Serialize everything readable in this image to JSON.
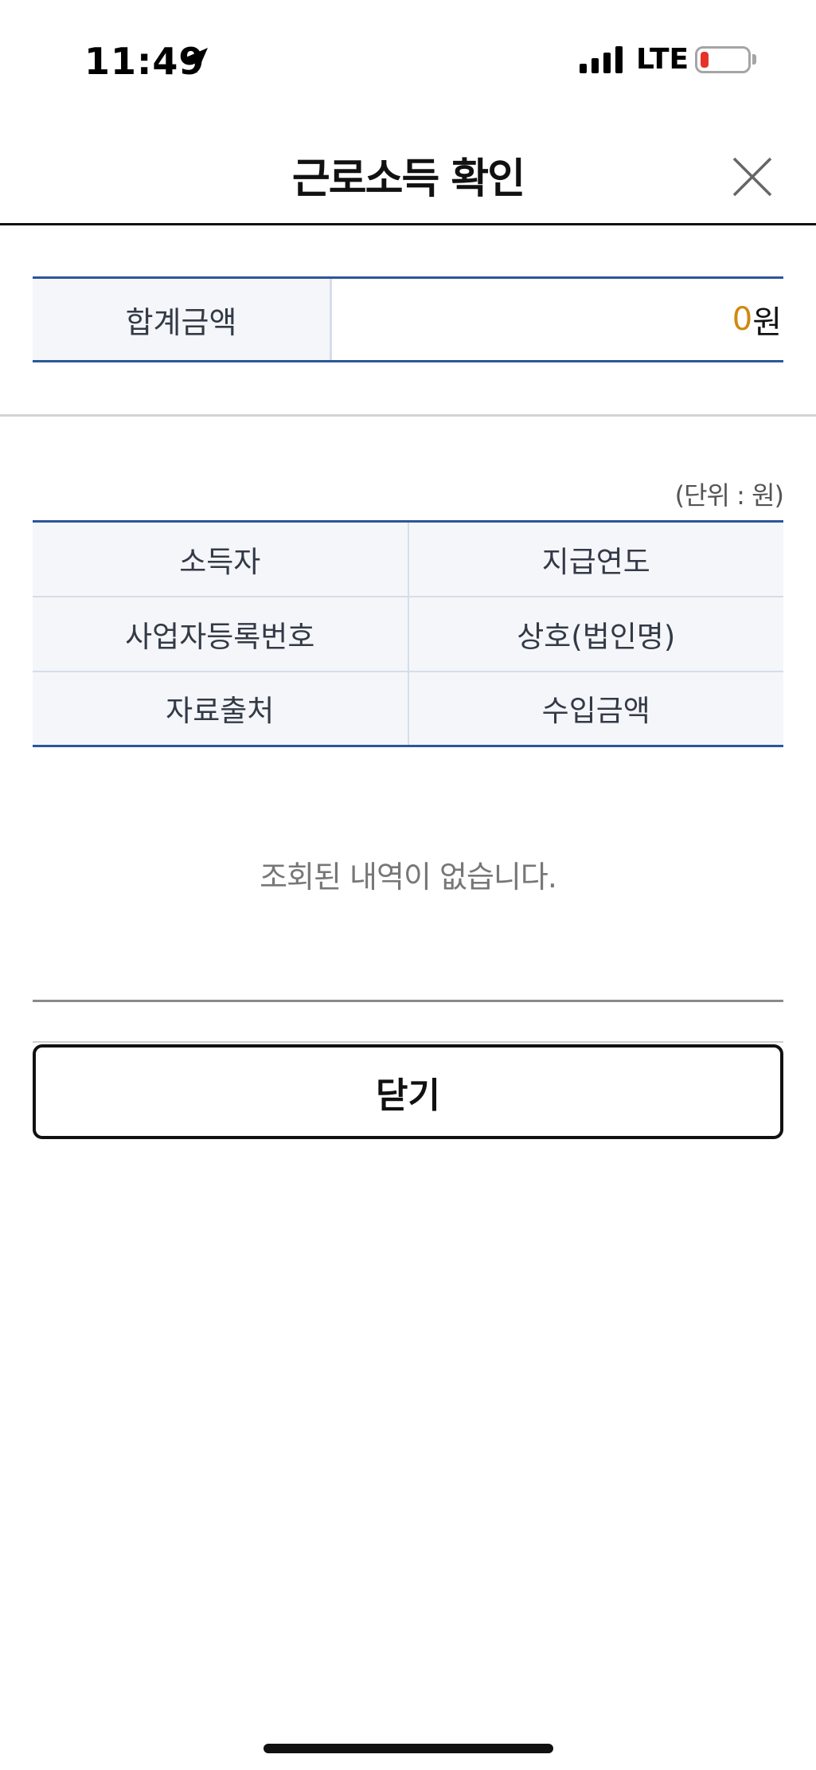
{
  "status_bar": {
    "time": "11:49",
    "network": "LTE",
    "battery_color": "#e5332a"
  },
  "header": {
    "title": "근로소득 확인",
    "close_icon": "close-icon"
  },
  "summary": {
    "label": "합계금액",
    "amount": "0",
    "currency": "원",
    "amount_color": "#d08811"
  },
  "table": {
    "unit": "(단위 : 원)",
    "headers": [
      [
        "소득자",
        "지급연도"
      ],
      [
        "사업자등록번호",
        "상호(법인명)"
      ],
      [
        "자료출처",
        "수입금액"
      ]
    ]
  },
  "empty_message": "조회된 내역이 없습니다.",
  "footer": {
    "close_label": "닫기"
  },
  "colors": {
    "accent_line": "#2c5699",
    "header_bg": "#f4f6fa"
  }
}
